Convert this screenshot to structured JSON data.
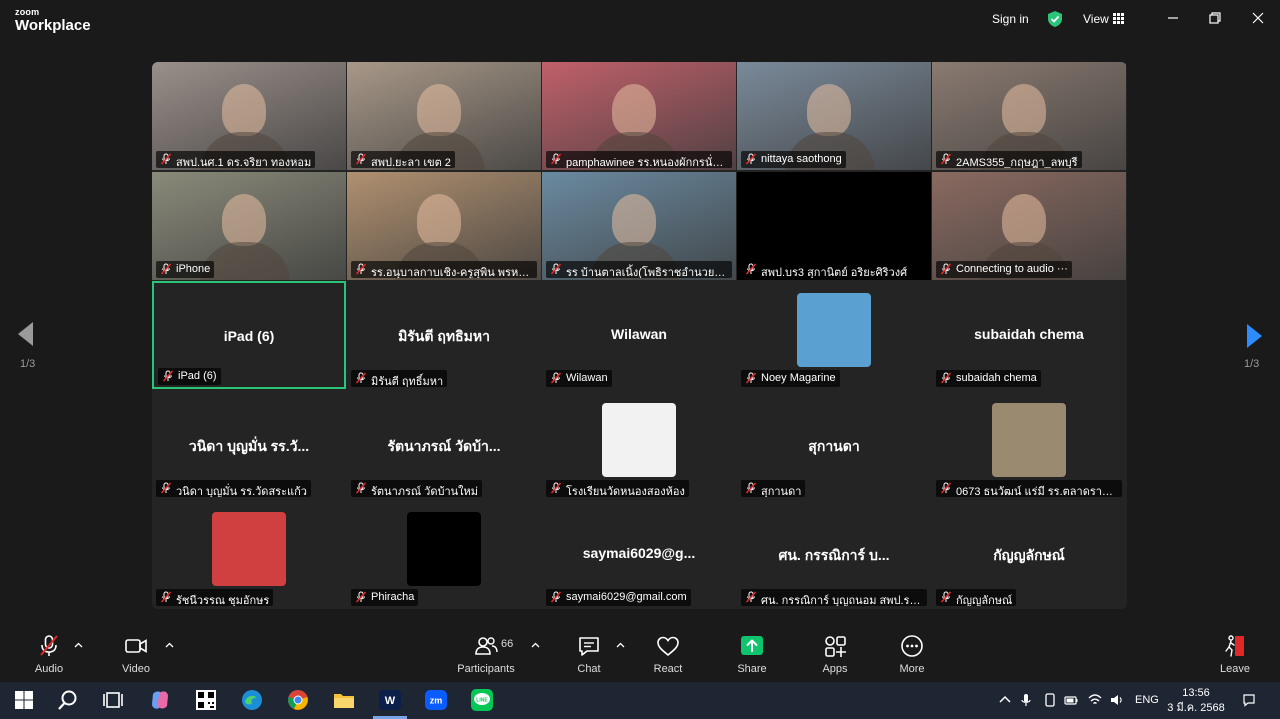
{
  "app": {
    "logo_top": "zoom",
    "logo_bottom": "Workplace",
    "sign_in": "Sign in",
    "view": "View"
  },
  "nav": {
    "page_left": "1/3",
    "page_right": "1/3"
  },
  "tiles": [
    {
      "label": "สพป.นศ.1 ดร.จริยา  ทองหอม",
      "type": "video",
      "color": "#9a8f8a"
    },
    {
      "label": "สพป.ยะลา เขต 2",
      "type": "video",
      "color": "#a89888"
    },
    {
      "label": "pamphawinee รร.หนองผักกรนั่น...",
      "type": "video",
      "color": "#c0606a"
    },
    {
      "label": "nittaya saothong",
      "type": "video",
      "color": "#7a8a9a"
    },
    {
      "label": "2AMS355_กฤษฎา_ลพบุรี",
      "type": "video",
      "color": "#8a7a70"
    },
    {
      "label": "iPhone",
      "type": "video",
      "color": "#8a8a7a"
    },
    {
      "label": "รร.อนุบาลกาบเชิง-ครูสุพิน พรหมอ...",
      "type": "video",
      "color": "#b09070"
    },
    {
      "label": "รร บ้านตาลเนิ้ง(โพธิราชอำนวย) ส...",
      "type": "video",
      "color": "#6a8aa0"
    },
    {
      "label": "สพป.บร3 สุกานิตย์ อริยะศิริวงศ์",
      "type": "black",
      "color": "#000000"
    },
    {
      "label": "Connecting to audio ···",
      "type": "video",
      "color": "#8a6a60"
    },
    {
      "label": "iPad (6)",
      "center": "iPad (6)",
      "type": "name",
      "active": true
    },
    {
      "label": "มิรันตี ฤทธิ์มหา",
      "center": "มิรันตี ฤทธิมหา",
      "type": "name"
    },
    {
      "label": "Wilawan",
      "center": "Wilawan",
      "type": "name"
    },
    {
      "label": "Noey Magarine",
      "type": "avatar",
      "color": "#5aa0d0"
    },
    {
      "label": "subaidah chema",
      "center": "subaidah chema",
      "type": "name"
    },
    {
      "label": "วนิดา บุญมั่น รร.วัดสระแก้ว",
      "center": "วนิดา บุญมั่น รร.วั...",
      "type": "name"
    },
    {
      "label": "รัตนาภรณ์ วัดบ้านใหม่",
      "center": "รัตนาภรณ์ วัดบ้า...",
      "type": "name"
    },
    {
      "label": "โรงเรียนวัดหนองสองห้อง",
      "type": "avatar",
      "color": "#f2f2f2"
    },
    {
      "label": "สุกานดา",
      "center": "สุกานดา",
      "type": "name"
    },
    {
      "label": "0673 ธนวัฒน์ แร่มี รร.ตลาดรางกร...",
      "type": "avatar",
      "color": "#9a8a70"
    },
    {
      "label": "รัชนีวรรณ ชุมอักษร",
      "type": "avatar",
      "color": "#d04040"
    },
    {
      "label": "Phiracha",
      "type": "avatar",
      "color": "#000000"
    },
    {
      "label": "saymai6029@gmail.com",
      "center": "saymai6029@g...",
      "type": "name"
    },
    {
      "label": "ศน. กรรณิการ์ บุญถนอม สพป.ราช...",
      "center": "ศน. กรรณิการ์ บ...",
      "type": "name"
    },
    {
      "label": "กัญญลักษณ์",
      "center": "กัญญลักษณ์",
      "type": "name"
    }
  ],
  "toolbar": {
    "audio": "Audio",
    "video": "Video",
    "participants": "Participants",
    "participants_count": "66",
    "chat": "Chat",
    "react": "React",
    "share": "Share",
    "apps": "Apps",
    "more": "More",
    "leave": "Leave"
  },
  "taskbar": {
    "lang": "ENG",
    "time": "13:56",
    "date": "3 มี.ค. 2568"
  },
  "colors": {
    "accent_green": "#2ac579",
    "share_green": "#0ec46c",
    "leave_red": "#e02828",
    "arrow_blue": "#2d8cff"
  }
}
